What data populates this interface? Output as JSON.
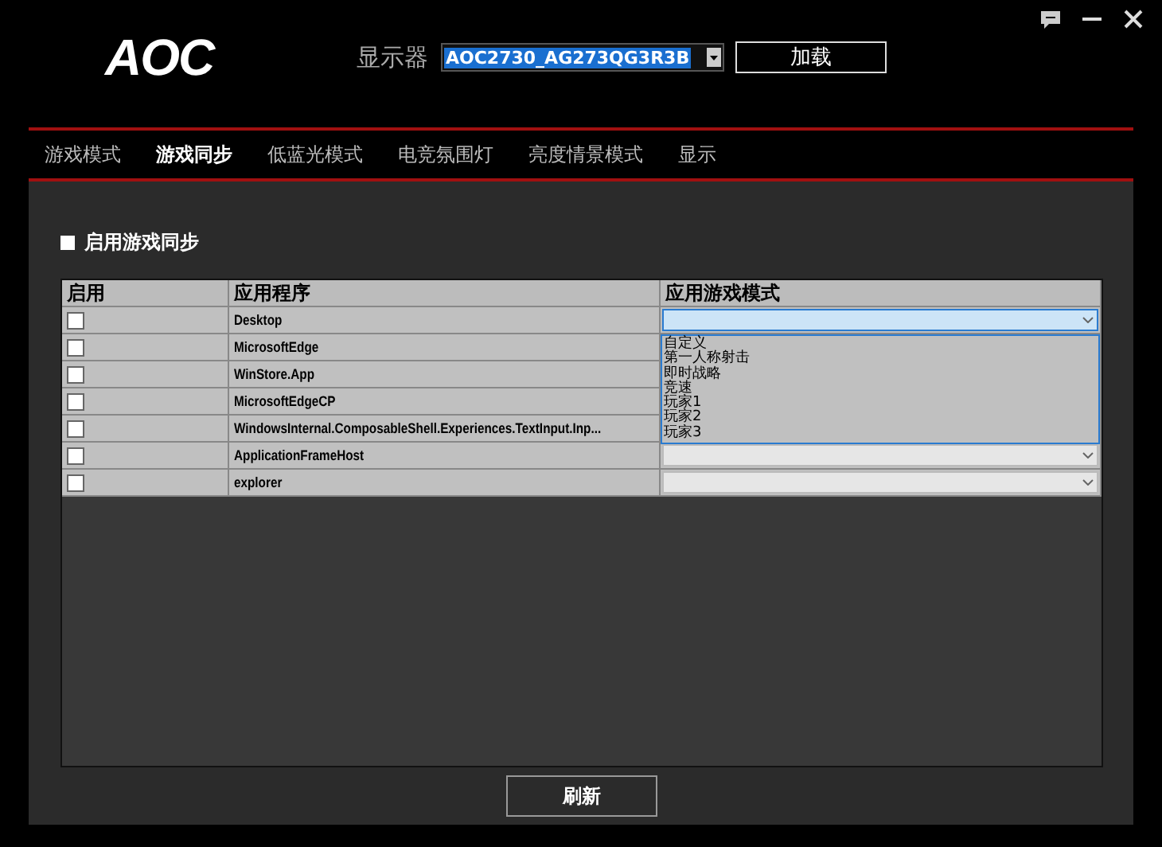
{
  "logo": "AOC",
  "monitor": {
    "label": "显示器",
    "value": "AOC2730_AG273QG3R3B"
  },
  "load_button": "加载",
  "tabs": [
    {
      "label": "游戏模式",
      "selected": false
    },
    {
      "label": "游戏同步",
      "selected": true
    },
    {
      "label": "低蓝光模式",
      "selected": false
    },
    {
      "label": "电竞氛围灯",
      "selected": false
    },
    {
      "label": "亮度情景模式",
      "selected": false
    },
    {
      "label": "显示",
      "selected": false
    }
  ],
  "sync_option": {
    "label": "启用游戏同步",
    "checked": false
  },
  "table": {
    "columns": [
      "启用",
      "应用程序",
      "应用游戏模式"
    ],
    "rows": [
      {
        "enabled": false,
        "app": "Desktop",
        "expanded": true
      },
      {
        "enabled": false,
        "app": "MicrosoftEdge",
        "expanded": false
      },
      {
        "enabled": false,
        "app": "WinStore.App",
        "expanded": false
      },
      {
        "enabled": false,
        "app": "MicrosoftEdgeCP",
        "expanded": false
      },
      {
        "enabled": false,
        "app": "WindowsInternal.ComposableShell.Experiences.TextInput.Inp...",
        "expanded": false
      },
      {
        "enabled": false,
        "app": "ApplicationFrameHost",
        "expanded": false
      },
      {
        "enabled": false,
        "app": "explorer",
        "expanded": false
      }
    ],
    "mode_options": [
      "自定义",
      "第一人称射击",
      "即时战略",
      "竞速",
      "玩家1",
      "玩家2",
      "玩家3"
    ]
  },
  "refresh_button": "刷新"
}
